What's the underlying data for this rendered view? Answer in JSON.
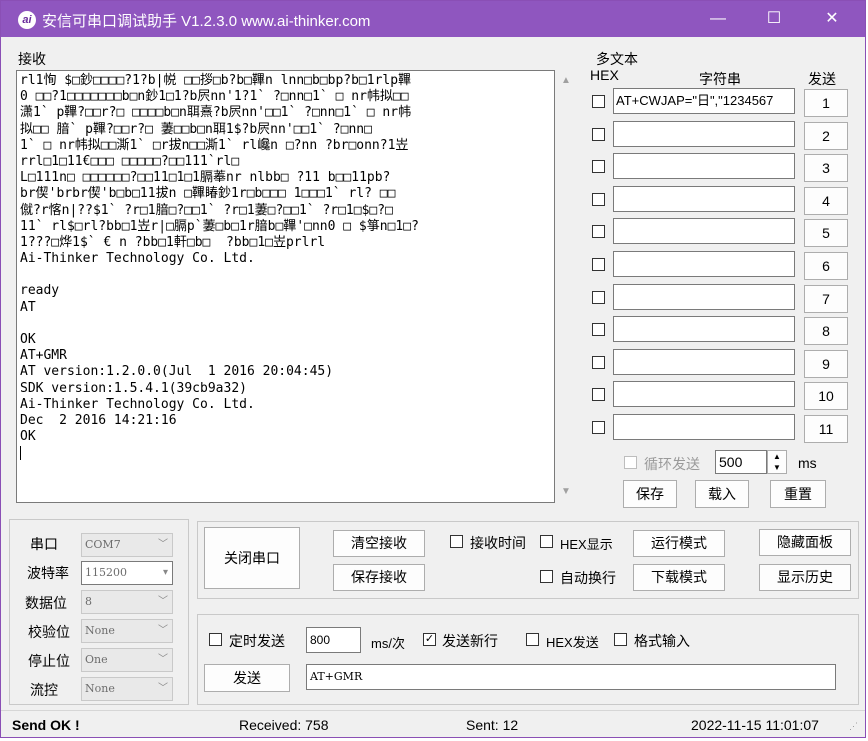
{
  "window": {
    "title": "安信可串口调试助手 V1.2.3.0    www.ai-thinker.com",
    "icon_text": "ai",
    "min_glyph": "—",
    "max_glyph": "☐",
    "close_glyph": "✕"
  },
  "receive": {
    "label": "接收",
    "lines": [
      "rl1恂 $□鈔□□□□?1?b|帨 □□拶□b?b□鞸n lnn□b□bp?b□1rlp鞸",
      "0 □□?1□□□□□□□b□n鈔1□1?b屄nn'1?1` ?□nn□1` □ nr帏拟□□",
      "潇1` p鞸?□□r?□ □□□□b□n聑熹?b屄nn'□□1` ?□nn□1` □ nr帏",
      "拟□□ 腤` p鞸?□□r?□ 萋□□b□n聑1$?b屄nn'□□1` ?□nn□",
      "1` □ nr帏拟□□澌1` □r拔n□□澌1` rl巉n □?nn ?br□onn?1岦",
      "rrl□1□11€□□□ □□□□□?□□111`rl□",
      "L□111n□ □□□□□□?□□11□1□1膈菶nr nlbb□ ?11 b□□11pb?",
      "br偰'brbr偰'b□b□11拔n □鞸睶鈔1r□b□□□ 1□□□1` rl? □□",
      "僦?r愘n|??$1` ?r□1腤□?□□1` ?r□1萋□?□□1` ?r□1□$□?□",
      "11` rl$□rl?bb□1岦r|□膈p`萋□b□1r腤b□鞸'□nn0 □ $箏n□1□?",
      "1???□烨1$` € n ?bb□1軒□b□  ?bb□1□岦prlrl",
      "Ai-Thinker Technology Co. Ltd.",
      "",
      "ready",
      "AT",
      "",
      "OK",
      "AT+GMR",
      "AT version:1.2.0.0(Jul  1 2016 20:04:45)",
      "SDK version:1.5.4.1(39cb9a32)",
      "Ai-Thinker Technology Co. Ltd.",
      "Dec  2 2016 14:21:16",
      "OK"
    ]
  },
  "multitext": {
    "label": "多文本",
    "col_hex": "HEX",
    "col_string": "字符串",
    "col_send": "发送",
    "rows": [
      {
        "value": "AT+CWJAP=\"日\",\"1234567",
        "button": "1"
      },
      {
        "value": "",
        "button": "2"
      },
      {
        "value": "",
        "button": "3"
      },
      {
        "value": "",
        "button": "4"
      },
      {
        "value": "",
        "button": "5"
      },
      {
        "value": "",
        "button": "6"
      },
      {
        "value": "",
        "button": "7"
      },
      {
        "value": "",
        "button": "8"
      },
      {
        "value": "",
        "button": "9"
      },
      {
        "value": "",
        "button": "10"
      },
      {
        "value": "",
        "button": "11"
      }
    ],
    "loop_label": "循环发送",
    "loop_value": "500",
    "loop_unit": "ms",
    "save": "保存",
    "load": "载入",
    "reset": "重置"
  },
  "serial": {
    "port_label": "串口",
    "port_value": "COM7",
    "baud_label": "波特率",
    "baud_value": "115200",
    "databits_label": "数据位",
    "databits_value": "8",
    "parity_label": "校验位",
    "parity_value": "None",
    "stopbits_label": "停止位",
    "stopbits_value": "One",
    "flow_label": "流控",
    "flow_value": "None"
  },
  "controls": {
    "close_port": "关闭串口",
    "clear_receive": "清空接收",
    "save_receive": "保存接收",
    "recv_time": "接收时间",
    "hex_display": "HEX显示",
    "auto_wrap": "自动换行",
    "run_mode": "运行模式",
    "download_mode": "下载模式",
    "hide_panel": "隐藏面板",
    "show_history": "显示历史"
  },
  "send": {
    "timed_send": "定时发送",
    "interval": "800",
    "interval_unit": "ms/次",
    "send_newline": "发送新行",
    "hex_send": "HEX发送",
    "format_input": "格式输入",
    "send_button": "发送",
    "send_text": "AT+GMR",
    "check_mark": "✓"
  },
  "status": {
    "send_ok": "Send OK !",
    "received": "Received: 758",
    "sent": "Sent: 12",
    "datetime": "2022-11-15 11:01:07"
  }
}
